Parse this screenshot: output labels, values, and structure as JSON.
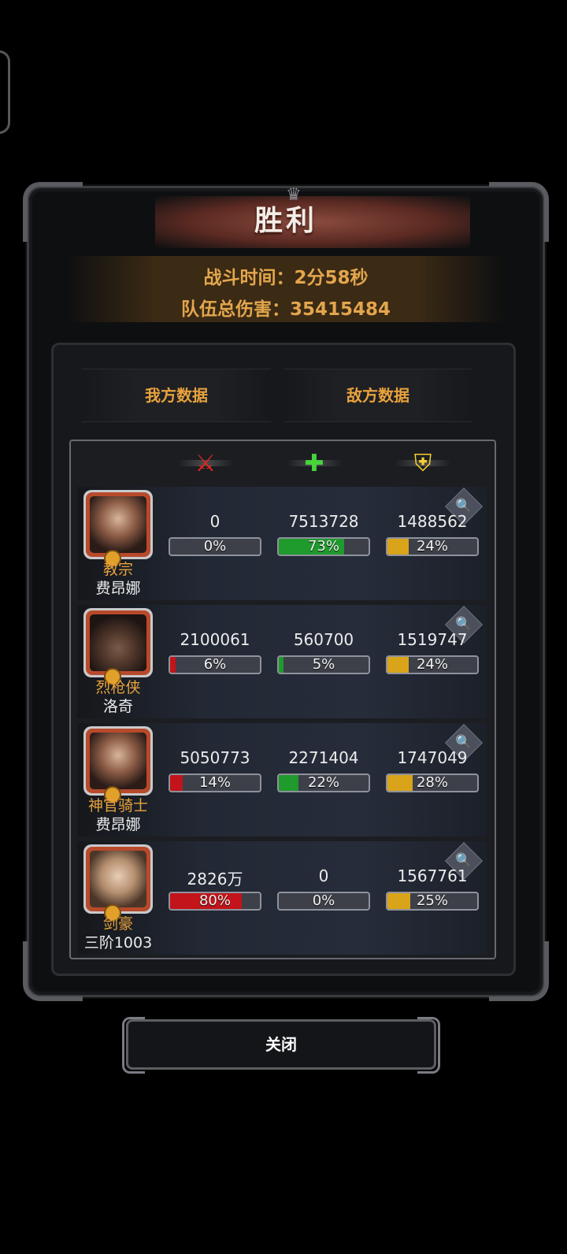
{
  "title": "胜利",
  "summary": {
    "battle_time": "战斗时间：2分58秒",
    "total_damage": "队伍总伤害：35415484"
  },
  "tabs": [
    {
      "label": "我方数据"
    },
    {
      "label": "敌方数据"
    }
  ],
  "header_icons": [
    "sword-icon",
    "heal-cross-icon",
    "shield-icon"
  ],
  "colors": {
    "accent": "#e8a23d",
    "damage": "#c2141a",
    "heal": "#1f9a2c",
    "shield": "#d9a41a"
  },
  "heroes": [
    {
      "class": "教宗",
      "name": "费昂娜",
      "portrait": "hooded-woman",
      "damage": {
        "value": "0",
        "pct": "0%"
      },
      "heal": {
        "value": "7513728",
        "pct": "73%"
      },
      "shield": {
        "value": "1488562",
        "pct": "24%"
      }
    },
    {
      "class": "烈枪侠",
      "name": "洛奇",
      "portrait": "cowboy-hat-man",
      "damage": {
        "value": "2100061",
        "pct": "6%"
      },
      "heal": {
        "value": "560700",
        "pct": "5%"
      },
      "shield": {
        "value": "1519747",
        "pct": "24%"
      }
    },
    {
      "class": "神官骑士",
      "name": "费昂娜",
      "portrait": "hooded-woman",
      "damage": {
        "value": "5050773",
        "pct": "14%"
      },
      "heal": {
        "value": "2271404",
        "pct": "22%"
      },
      "shield": {
        "value": "1747049",
        "pct": "28%"
      }
    },
    {
      "class": "剑豪",
      "name": "三阶1003",
      "portrait": "blonde-woman",
      "damage": {
        "value": "2826万",
        "pct": "80%"
      },
      "heal": {
        "value": "0",
        "pct": "0%"
      },
      "shield": {
        "value": "1567761",
        "pct": "25%"
      }
    }
  ],
  "close_label": "关闭"
}
